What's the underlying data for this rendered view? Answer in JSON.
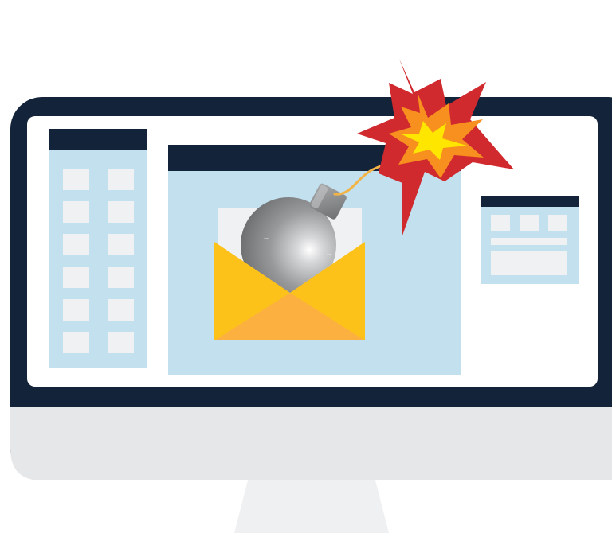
{
  "illustration": {
    "subject": "computer-monitor-with-email-bomb",
    "icons": [
      "monitor-icon",
      "envelope-icon",
      "bomb-icon",
      "explosion-icon",
      "window-icon"
    ],
    "colors": {
      "bezel": "#13233a",
      "screen": "#ffffff",
      "window_fill": "#c2e0ee",
      "window_bar": "#13233a",
      "tile": "#eff1f3",
      "chin": "#e6e7e9",
      "stand": "#eff0f2",
      "envelope": "#fdc21a",
      "envelope_front": "#fbb040",
      "bomb": "#8a8b8d",
      "blast_outer": "#d02a2f",
      "blast_mid": "#f7901e",
      "blast_core": "#ffe600"
    },
    "left_panel_tile_rows": 6,
    "left_panel_tile_cols": 2
  }
}
